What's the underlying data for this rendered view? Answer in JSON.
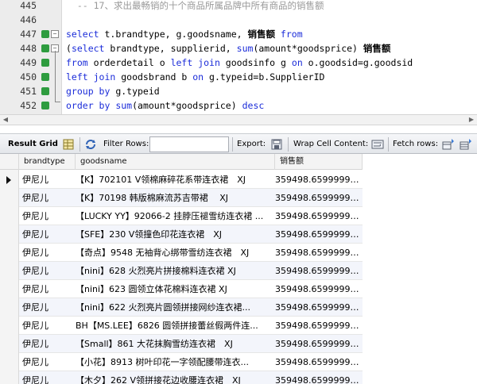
{
  "editor": {
    "lines": [
      {
        "num": "445",
        "parts": [
          {
            "t": "  -- 17、求出最畅销的十个商品所属品牌中所有商品的销售额",
            "c": "cm"
          }
        ]
      },
      {
        "num": "446",
        "parts": []
      },
      {
        "num": "447",
        "parts": [
          {
            "t": "select",
            "c": "kw"
          },
          {
            "t": " t.brandtype, g.goodsname, "
          },
          {
            "t": "销售额",
            "c": "cjk"
          },
          {
            "t": " "
          },
          {
            "t": "from",
            "c": "kw"
          }
        ]
      },
      {
        "num": "448",
        "parts": [
          {
            "t": "("
          },
          {
            "t": "select",
            "c": "kw"
          },
          {
            "t": " brandtype, supplierid, "
          },
          {
            "t": "sum",
            "c": "kw"
          },
          {
            "t": "(amount*goodsprice) "
          },
          {
            "t": "销售额",
            "c": "cjk"
          }
        ]
      },
      {
        "num": "449",
        "parts": [
          {
            "t": "from",
            "c": "kw"
          },
          {
            "t": " orderdetail o "
          },
          {
            "t": "left join",
            "c": "kw"
          },
          {
            "t": " goodsinfo g "
          },
          {
            "t": "on",
            "c": "kw"
          },
          {
            "t": " o.goodsid=g.goodsid"
          }
        ]
      },
      {
        "num": "450",
        "parts": [
          {
            "t": "left join",
            "c": "kw"
          },
          {
            "t": " goodsbrand b "
          },
          {
            "t": "on",
            "c": "kw"
          },
          {
            "t": " g.typeid=b.SupplierID"
          }
        ]
      },
      {
        "num": "451",
        "parts": [
          {
            "t": "group by",
            "c": "kw"
          },
          {
            "t": " g.typeid"
          }
        ]
      },
      {
        "num": "452",
        "parts": [
          {
            "t": "order by",
            "c": "kw"
          },
          {
            "t": " "
          },
          {
            "t": "sum",
            "c": "kw"
          },
          {
            "t": "(amount*goodsprice) "
          },
          {
            "t": "desc",
            "c": "kw"
          }
        ]
      },
      {
        "num": "453",
        "parts": [
          {
            "t": "limit",
            "c": "kw"
          },
          {
            "t": " 10) t "
          },
          {
            "t": "right join",
            "c": "kw"
          },
          {
            "t": " goodsinfo g "
          },
          {
            "t": "on",
            "c": "kw"
          },
          {
            "t": " t.supplierid=g.typeid"
          }
        ]
      },
      {
        "num": "454",
        "parts": []
      }
    ]
  },
  "toolbar": {
    "result_grid": "Result Grid",
    "filter_rows": "Filter Rows:",
    "filter_value": "",
    "export": "Export:",
    "wrap": "Wrap Cell Content:",
    "fetch": "Fetch rows:"
  },
  "grid": {
    "columns": [
      "brandtype",
      "goodsname",
      "销售额"
    ],
    "rows": [
      [
        "伊尼儿",
        "【K】702101 V领棉麻碎花系带连衣裙　XJ",
        "359498.659999998"
      ],
      [
        "伊尼儿",
        "【K】70198 韩版棉麻流苏吉带裙　 XJ",
        "359498.659999998"
      ],
      [
        "伊尼儿",
        "【LUCKY YY】92066-2 挂脖压褪雪纺连衣裙 ...",
        "359498.659999998"
      ],
      [
        "伊尼儿",
        "【SFE】230 V领撞色印花连衣裙　XJ",
        "359498.659999998"
      ],
      [
        "伊尼儿",
        "【奇点】9548 无袖背心绑带雪纺连衣裙　XJ",
        "359498.659999998"
      ],
      [
        "伊尼儿",
        "【nini】628 火烈亮片拼接棉料连衣裙 XJ",
        "359498.659999998"
      ],
      [
        "伊尼儿",
        "【nini】623 圆领立体花棉料连衣裙 XJ",
        "359498.659999998"
      ],
      [
        "伊尼儿",
        "【nini】622 火烈亮片圆领拼接网纱连衣裙...",
        "359498.659999998"
      ],
      [
        "伊尼儿",
        "BH【MS.LEE】6826 圆领拼接蕾丝假两件连...",
        "359498.659999998"
      ],
      [
        "伊尼儿",
        "【Small】861 大花抹胸雪纺连衣裙　XJ",
        "359498.659999998"
      ],
      [
        "伊尼儿",
        "【小花】8913 树叶印花一字领配腰带连衣...",
        "359498.659999998"
      ],
      [
        "伊尼儿",
        "【木夕】262 V领拼接花边收腰连衣裙　XJ",
        "359498.659999998"
      ]
    ]
  }
}
